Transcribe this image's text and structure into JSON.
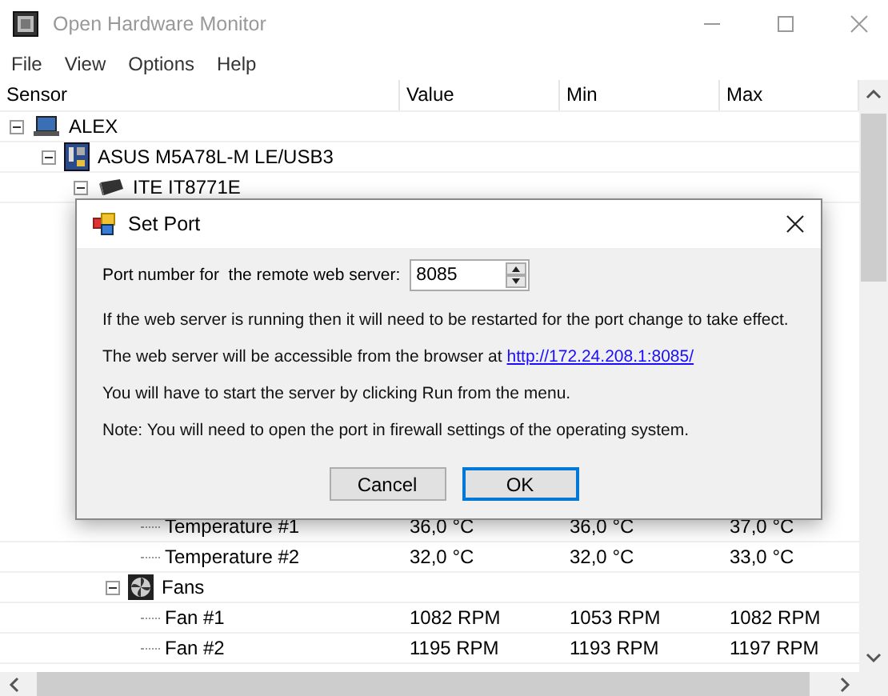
{
  "window": {
    "title": "Open Hardware Monitor"
  },
  "menu": [
    "File",
    "View",
    "Options",
    "Help"
  ],
  "columns": [
    "Sensor",
    "Value",
    "Min",
    "Max"
  ],
  "tree": [
    {
      "label": "ALEX",
      "kind": "computer",
      "expanded": true,
      "children": [
        {
          "label": "ASUS M5A78L-M LE/USB3",
          "kind": "motherboard",
          "expanded": true,
          "children": [
            {
              "label": "ITE IT8771E",
              "kind": "chip",
              "expanded": true,
              "children": [
                {
                  "children": [
                    {
                      "label": "Temperature #1",
                      "value": "36,0 °C",
                      "min": "36,0 °C",
                      "max": "37,0 °C"
                    },
                    {
                      "label": "Temperature #2",
                      "value": "32,0 °C",
                      "min": "32,0 °C",
                      "max": "33,0 °C"
                    }
                  ]
                },
                {
                  "label": "Fans",
                  "kind": "fan",
                  "expanded": true,
                  "children": [
                    {
                      "label": "Fan #1",
                      "value": "1082 RPM",
                      "min": "1053 RPM",
                      "max": "1082 RPM"
                    },
                    {
                      "label": "Fan #2",
                      "value": "1195 RPM",
                      "min": "1193 RPM",
                      "max": "1197 RPM"
                    }
                  ]
                }
              ]
            }
          ]
        }
      ]
    }
  ],
  "dialog": {
    "title": "Set Port",
    "port_label": "Port number for  the remote web server:",
    "port_value": "8085",
    "lines": [
      {
        "text": "If the web server is running then it will need to be restarted for the port change to take effect."
      },
      {
        "text": "The web server will be accessible from the browser at",
        "link": "http://172.24.208.1:8085/"
      },
      {
        "text": "You will have to start the server by clicking Run from the menu."
      },
      {
        "text": "Note: You will need to open the port in firewall settings of the operating system."
      }
    ],
    "buttons": [
      {
        "label": "Cancel",
        "default": false
      },
      {
        "label": "OK",
        "default": true
      }
    ]
  }
}
